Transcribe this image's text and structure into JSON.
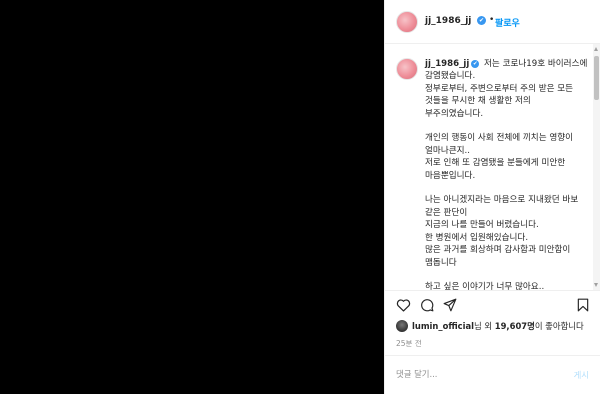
{
  "post": {
    "username": "jj_1986_jj",
    "verified_glyph": "✔",
    "separator": "•",
    "follow_label": "팔로우",
    "avatar": "profile-avatar"
  },
  "caption": {
    "username": "jj_1986_jj",
    "verified_glyph": "✔",
    "text": " 저는 코로나19호 바이러스에 감염됐습니다.\n정부로부터, 주변으로부터 주의 받은 모든 것들을 무시한 채 생활한 저의 부주의였습니다.\n\n개인의 행동이 사회 전체에 끼치는 영향이 얼마나큰지..\n저로 인해 또 감염됐을 분들에게 미안한 마음뿐입니다.\n\n나는 아니겠지라는 마음으로 지내왔던 바보 같은 판단이\n지금의 나를 만들어 버렸습니다.\n한 병원에서 입원해있습니다.\n많은 과거를 회상하며 감사함과 미안함이 맴돕니다\n\n하고 싶은 이야기가 너무 많아요..\n너무 많은 사람들이 보고 싶어요"
  },
  "actions": {
    "icons": [
      "heart-icon",
      "comment-icon",
      "share-icon",
      "bookmark-icon"
    ]
  },
  "likes": {
    "user": "lumin_official",
    "rest": "님 외 ",
    "count": "19,607명",
    "suffix": "이 좋아합니다"
  },
  "time": "25분 전",
  "comment": {
    "placeholder": "댓글 달기...",
    "post_label": "게시"
  },
  "colors": {
    "accent": "#0095f6",
    "verified": "#3897f0",
    "media_bg": "#000000"
  }
}
